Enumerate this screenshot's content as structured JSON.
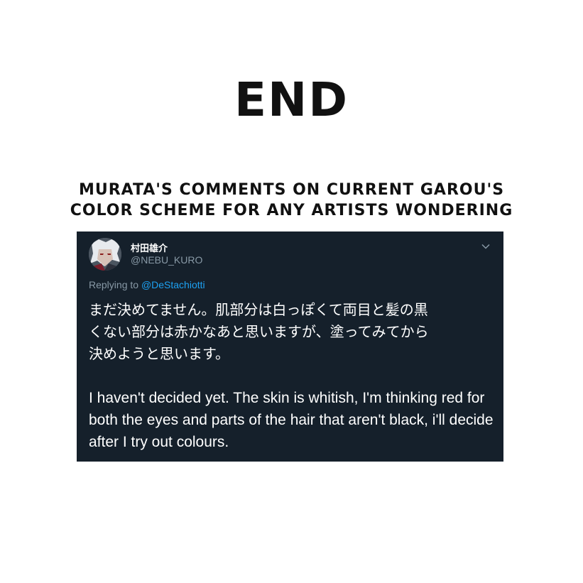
{
  "page": {
    "end_title": "END",
    "caption_line1": "MURATA'S COMMENTS ON CURRENT GAROU'S",
    "caption_line2": "COLOR SCHEME FOR ANY ARTISTS WONDERING"
  },
  "tweet": {
    "display_name": "村田雄介",
    "handle": "@NEBU_KURO",
    "replying_prefix": "Replying to",
    "replying_mention": "@DeStachiotti",
    "text_jp": "まだ決めてません。肌部分は白っぽくて両目と髪の黒\nくない部分は赤かなあと思いますが、塗ってみてから\n決めようと思います。",
    "text_en": "I haven't decided yet. The skin is whitish, I'm thinking red for both the eyes and parts of the hair that aren't black, i'll decide after I try out colours.",
    "icons": {
      "menu": "chevron-down-icon",
      "avatar": "avatar"
    }
  },
  "colors": {
    "tweet_background": "#15202b",
    "text_secondary": "#8899a6",
    "link": "#1da1f2"
  }
}
